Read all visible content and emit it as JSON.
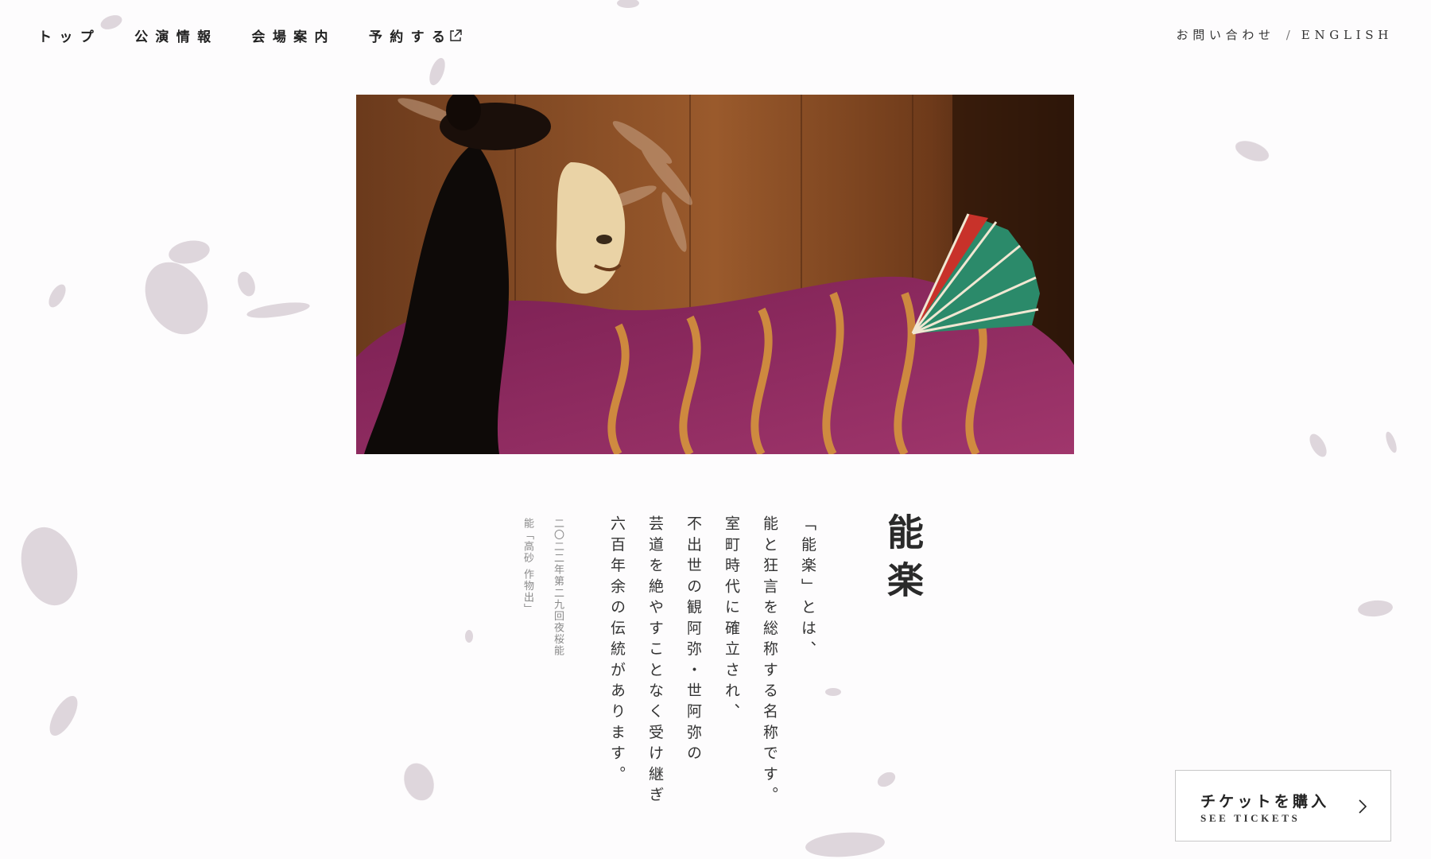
{
  "nav": {
    "items": [
      {
        "label": "トップ"
      },
      {
        "label": "公演情報"
      },
      {
        "label": "会場案内"
      },
      {
        "label": "予約する",
        "icon": "external-link-icon"
      }
    ],
    "contact": "お問い合わせ",
    "separator": "/",
    "english": "ENGLISH"
  },
  "hero": {
    "icon": "noh-performer-photo"
  },
  "section": {
    "title": "能楽",
    "paragraphs": [
      "「能楽」とは、",
      "能と狂言を総称する名称です。",
      "室町時代に確立され、",
      "不出世の観阿弥・世阿弥の",
      "芸道を絶やすことなく受け継ぎ",
      "六百年余の伝統があります。"
    ],
    "caption": [
      "二〇二二年第二九回夜桜能",
      "能「高砂 作物出」"
    ]
  },
  "ticket": {
    "label_jp": "チケットを購入",
    "label_en": "SEE TICKETS",
    "icon": "chevron-right-icon"
  },
  "colors": {
    "background": "#fdfcfd",
    "text": "#222222",
    "petal": "#d9cfd4"
  }
}
